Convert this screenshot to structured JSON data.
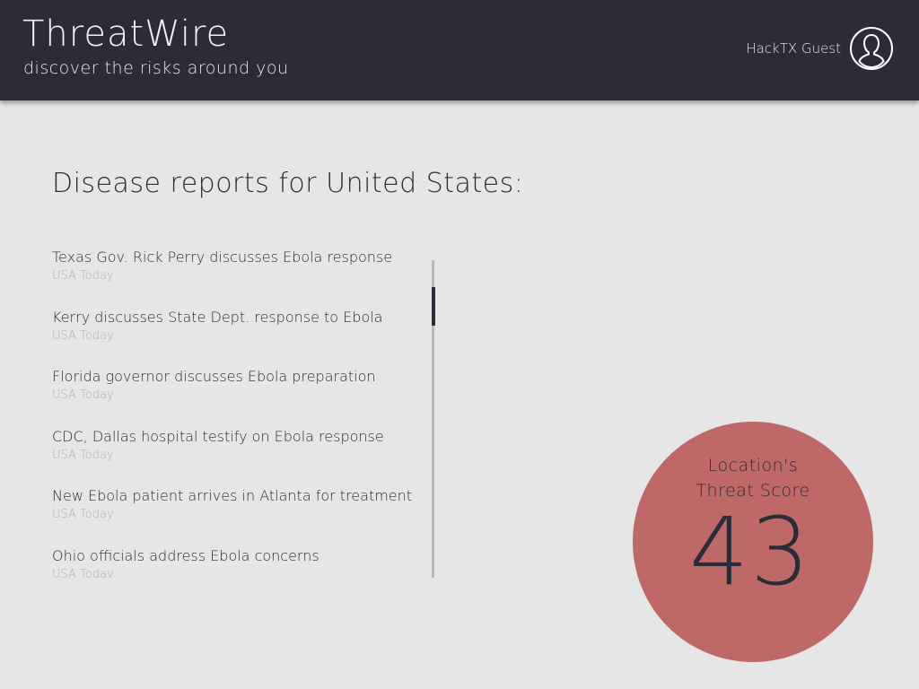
{
  "header": {
    "title": "ThreatWire",
    "tagline": "discover the risks around you",
    "user_name": "HackTX Guest",
    "avatar_icon": "user-circle-icon"
  },
  "main": {
    "heading": "Disease reports for United States:",
    "reports": [
      {
        "title": "Texas Gov. Rick Perry discusses Ebola response",
        "source": "USA Today"
      },
      {
        "title": "Kerry discusses State Dept. response to Ebola",
        "source": "USA Today"
      },
      {
        "title": "Florida governor discusses Ebola preparation",
        "source": "USA Today"
      },
      {
        "title": "CDC, Dallas hospital testify on Ebola response",
        "source": "USA Today"
      },
      {
        "title": "New Ebola patient arrives in Atlanta for treatment",
        "source": "USA Today"
      },
      {
        "title": "Ohio officials address Ebola concerns",
        "source": "USA Today"
      }
    ]
  },
  "threat": {
    "label_line1": "Location's",
    "label_line2": "Threat Score",
    "score": "43"
  },
  "colors": {
    "header_bg": "#2b2c37",
    "page_bg": "#e6e6e6",
    "threat_circle": "#bf6868",
    "source_text": "#aeaeae"
  }
}
